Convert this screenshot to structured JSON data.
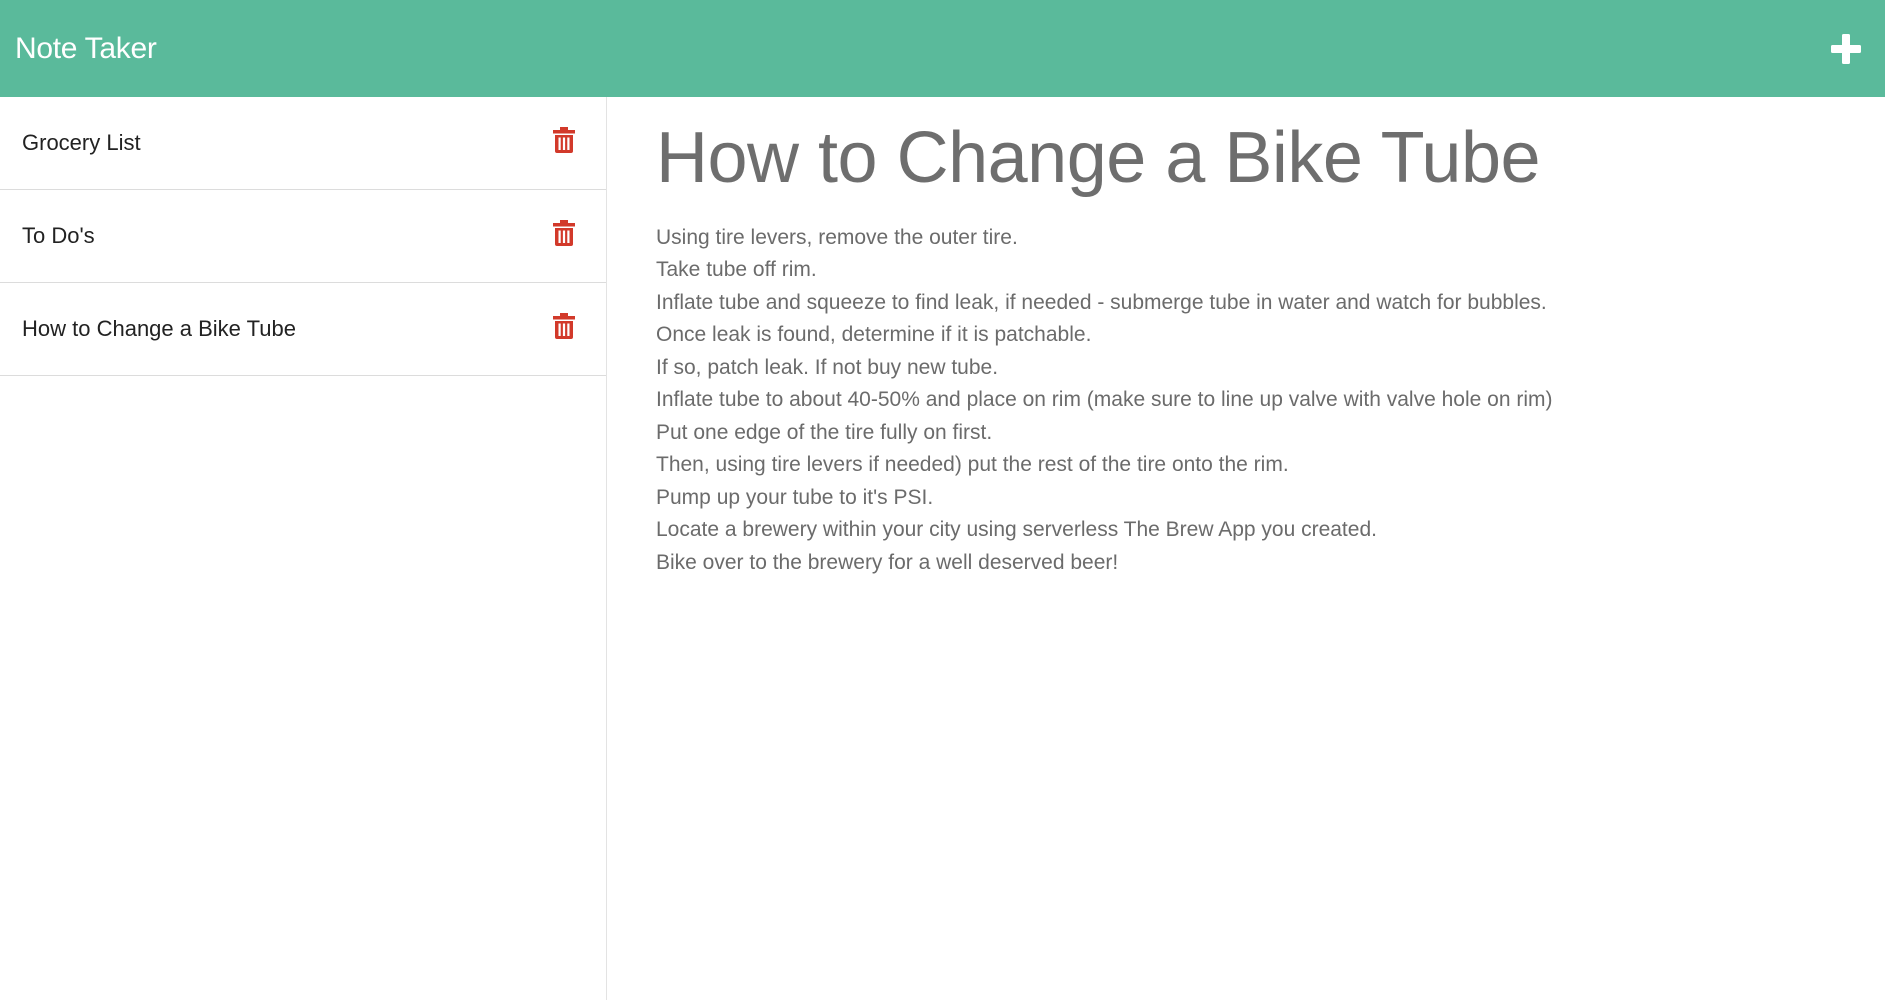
{
  "app": {
    "title": "Note Taker",
    "accent_color": "#5aba9b",
    "new_note_icon": "plus-icon"
  },
  "sidebar": {
    "delete_icon": "trash-icon",
    "delete_color": "#d2392a",
    "notes": [
      {
        "label": "Grocery List"
      },
      {
        "label": "To Do's"
      },
      {
        "label": "How to Change a Bike Tube"
      }
    ]
  },
  "editor": {
    "title": "How to Change a Bike Tube",
    "lines": [
      "Using tire levers, remove the outer tire.",
      "Take tube off rim.",
      "Inflate tube and squeeze to find leak, if needed - submerge tube in water and watch for bubbles.",
      "Once leak is found, determine if it is patchable.",
      "If so, patch leak. If not buy new tube.",
      "Inflate tube to about 40-50% and place on rim (make sure to line up valve with valve hole on rim)",
      "Put one edge of the tire fully on first.",
      "Then, using tire levers if needed) put the rest of the tire onto the rim.",
      "Pump up your tube to it's PSI.",
      "Locate a brewery within your city using serverless The Brew App you created.",
      "Bike over to the brewery for a well deserved beer!"
    ]
  }
}
